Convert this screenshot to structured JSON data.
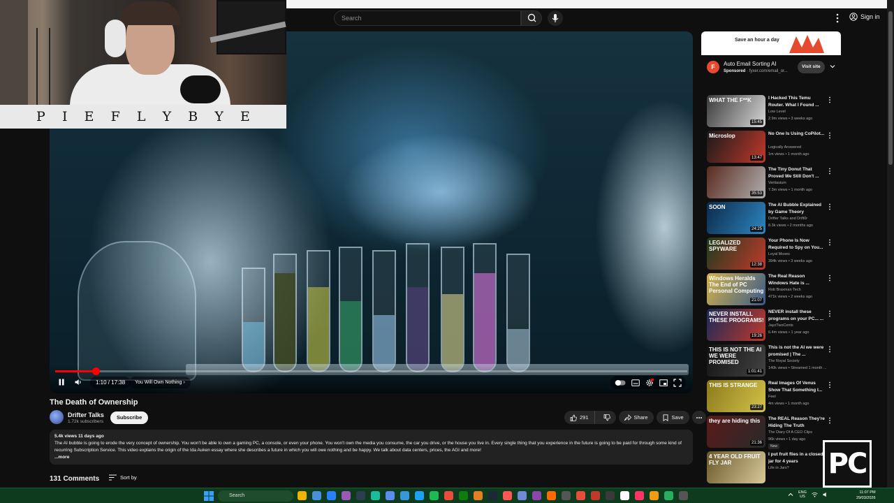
{
  "header": {
    "search_placeholder": "Search",
    "sign_in": "Sign in"
  },
  "overlay": {
    "banner_letters": [
      "P",
      "I",
      "E",
      "F",
      "L",
      "Y",
      "B",
      "Y",
      "E"
    ]
  },
  "player": {
    "progress_fraction": 0.064,
    "time": "1:10 / 17:38",
    "chapter": "You Will Own Nothing"
  },
  "video": {
    "title": "The Death of Ownership",
    "channel": "Drifter Talks",
    "subscribers": "1.72k subscribers",
    "subscribe_label": "Subscribe",
    "likes": "291",
    "share_label": "Share",
    "save_label": "Save",
    "meta": "5.4k views  11 days ago",
    "description": "The AI bubble is going to erode the very concept of ownership. You won't be able to own a gaming PC, a console, or even your phone. You won't own the media you consume, the car you drive, or the house you live in. Every single thing that you experience in the future is going to be paid for through some kind of recurring Subscription Service. This video explains the origin of the Ida Auken essay where she describes a future in which you will owe nothing and be happy. We talk about data centers, prices, the AGI and more!",
    "more": "...more",
    "comments_count": "131 Comments",
    "sort_by": "Sort by"
  },
  "ad": {
    "image_text": "Save an hour a day",
    "title": "Auto Email Sorting AI",
    "sponsored": "Sponsored",
    "domain": "· fyxer.com/email_or...",
    "visit": "Visit site",
    "icon_letter": "F"
  },
  "recommendations": [
    {
      "title": "I Hacked This Temu Router. What I Found ...",
      "channel": "Low Level",
      "meta": "2.9m views • 3 weeks ago",
      "duration": "15:45",
      "thumb_text": "WHAT THE F**K",
      "colors": [
        "#3a3a3a",
        "#d8d8d8"
      ]
    },
    {
      "title": "No One Is Using CoPilot...",
      "channel": "Logically Answered",
      "meta": "1m views • 1 month ago",
      "duration": "13:47",
      "thumb_text": "Microslop",
      "colors": [
        "#1a1a1a",
        "#c0392b"
      ]
    },
    {
      "title": "The Tiny Donut That Proved We Still Don't ...",
      "channel": "Veritasium",
      "meta": "7.3m views • 1 month ago",
      "duration": "35:53",
      "thumb_text": "",
      "colors": [
        "#5a2a1e",
        "#b0b0b0"
      ]
    },
    {
      "title": "The AI Bubble Explained by Game Theory",
      "channel": "Drifter Talks and Drift0r",
      "meta": "8.3k views • 2 months ago",
      "duration": "24:25",
      "thumb_text": "SOON",
      "colors": [
        "#0b2a4a",
        "#2e86c1"
      ]
    },
    {
      "title": "Your Phone Is Now Required to Spy on You...",
      "channel": "Loyal Moses",
      "meta": "394k views • 3 weeks ago",
      "duration": "12:38",
      "thumb_text": "LEGALIZED SPYWARE",
      "colors": [
        "#1e3c1e",
        "#c0392b"
      ]
    },
    {
      "title": "The Real Reason Windows Hate is ...",
      "channel": "Rob Braxman Tech",
      "meta": "471k views • 2 weeks ago",
      "duration": "21:07",
      "thumb_text": "Windows Heralds The End of PC Personal Computing",
      "colors": [
        "#d4b24a",
        "#3b5a8a"
      ]
    },
    {
      "title": "NEVER install these programs on your PC... ...",
      "channel": "JayzTwoCents",
      "meta": "6.4m views • 1 year ago",
      "duration": "19:26",
      "thumb_text": "NEVER INSTALL THESE PROGRAMS!",
      "colors": [
        "#1a2a5a",
        "#c0392b"
      ]
    },
    {
      "title": "This is not the AI we were promised | The ...",
      "channel": "The Royal Society",
      "meta": "140k views • Streamed 1 month ...",
      "duration": "1:01:41",
      "thumb_text": "THIS IS NOT THE AI WE WERE PROMISED",
      "colors": [
        "#111111",
        "#444444"
      ]
    },
    {
      "title": "Real Images Of Venus Show That Something I...",
      "channel": "Feel",
      "meta": "4m views • 1 month ago",
      "duration": "23:27",
      "thumb_text": "THIS IS STRANGE",
      "colors": [
        "#8a7a1a",
        "#d4c24a"
      ]
    },
    {
      "title": "The REAL Reason They're Hiding The Truth",
      "channel": "The Diary Of A CEO Clips",
      "meta": "96k views • 1 day ago",
      "duration": "21:36",
      "thumb_text": "they are hiding this",
      "badge": "New",
      "colors": [
        "#5a1a1a",
        "#2a2a2a"
      ]
    },
    {
      "title": "I put fruit flies in a closed jar for 4 years",
      "channel": "Life in Jars?",
      "meta": "",
      "duration": "",
      "thumb_text": "4 YEAR OLD FRUIT FLY JAR",
      "colors": [
        "#6a5a2a",
        "#d8c89a"
      ]
    }
  ],
  "pc_logo": "PC",
  "taskbar": {
    "search": "Search",
    "lang_line1": "ENG",
    "lang_line2": "US",
    "time": "11:07 PM",
    "date": "29/03/2026"
  }
}
